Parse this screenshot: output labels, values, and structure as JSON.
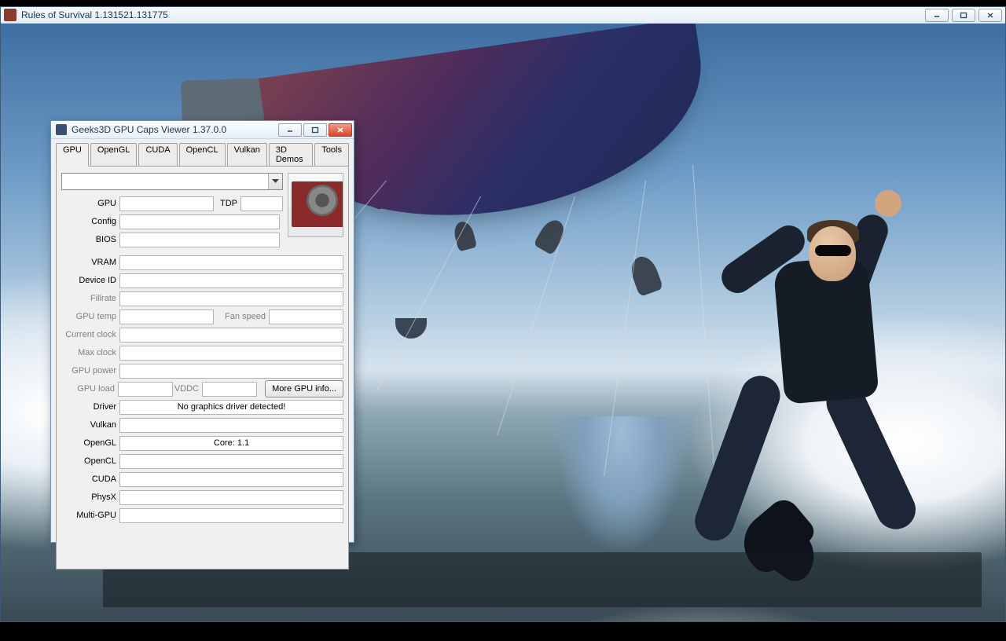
{
  "game_window": {
    "title": "Rules of Survival 1.131521.131775"
  },
  "gcv_window": {
    "title": "Geeks3D GPU Caps Viewer 1.37.0.0",
    "tabs": [
      "GPU",
      "OpenGL",
      "CUDA",
      "OpenCL",
      "Vulkan",
      "3D Demos",
      "Tools"
    ],
    "active_tab": "GPU",
    "combo_value": "",
    "labels": {
      "gpu": "GPU",
      "tdp": "TDP",
      "config": "Config",
      "bios": "BIOS",
      "vram": "VRAM",
      "device_id": "Device ID",
      "fillrate": "Fillrate",
      "gpu_temp": "GPU temp",
      "fan_speed": "Fan speed",
      "current_clock": "Current clock",
      "max_clock": "Max clock",
      "gpu_power": "GPU power",
      "gpu_load": "GPU load",
      "vddc": "VDDC",
      "more_gpu_info": "More GPU info...",
      "driver": "Driver",
      "vulkan": "Vulkan",
      "opengl": "OpenGL",
      "opencl": "OpenCL",
      "cuda": "CUDA",
      "physx": "PhysX",
      "multi_gpu": "Multi-GPU"
    },
    "values": {
      "gpu": "",
      "tdp": "",
      "config": "",
      "bios": "",
      "vram": "",
      "device_id": "",
      "fillrate": "",
      "gpu_temp": "",
      "fan_speed": "",
      "current_clock": "",
      "max_clock": "",
      "gpu_power": "",
      "gpu_load": "",
      "vddc": "",
      "driver": "No graphics driver detected!",
      "vulkan": "",
      "opengl": "Core: 1.1",
      "opencl": "",
      "cuda": "",
      "physx": "",
      "multi_gpu": ""
    }
  }
}
